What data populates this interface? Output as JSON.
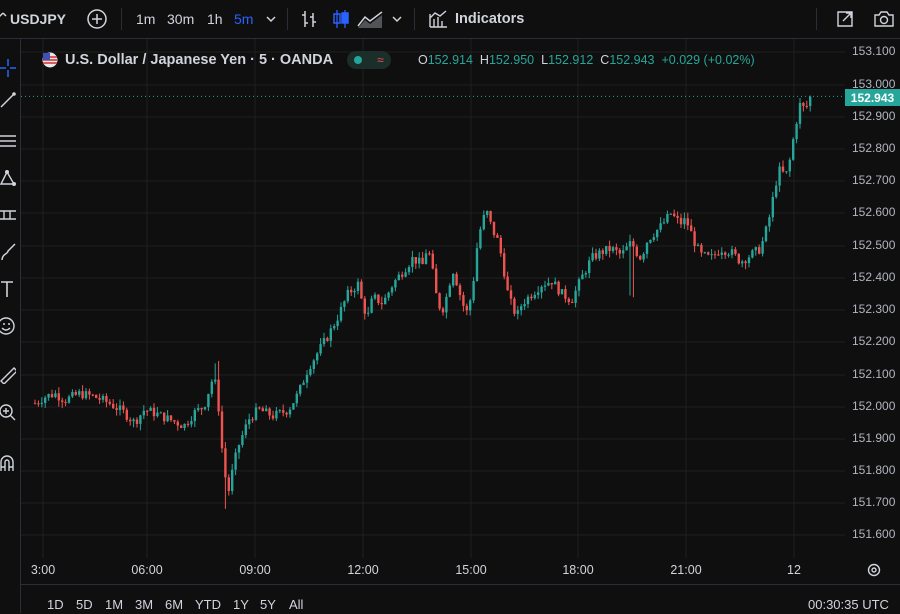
{
  "toolbar": {
    "symbol": "USDJPY",
    "intervals": [
      "1m",
      "30m",
      "1h",
      "5m"
    ],
    "active_interval": "5m",
    "indicators_label": "Indicators"
  },
  "legend": {
    "title": "U.S. Dollar / Japanese Yen · 5 · OANDA",
    "o_label": "O",
    "o": "152.914",
    "h_label": "H",
    "h": "152.950",
    "l_label": "L",
    "l": "152.912",
    "c_label": "C",
    "c": "152.943",
    "change": "+0.029 (+0.02%)"
  },
  "price_axis": {
    "ticks": [
      "153.100",
      "153.000",
      "152.900",
      "152.800",
      "152.700",
      "152.600",
      "152.500",
      "152.400",
      "152.300",
      "152.200",
      "152.100",
      "152.000",
      "151.900",
      "151.800",
      "151.700",
      "151.600"
    ],
    "last_price": "152.943"
  },
  "time_axis": {
    "ticks": [
      "3:00",
      "06:00",
      "09:00",
      "12:00",
      "15:00",
      "18:00",
      "21:00",
      "12"
    ]
  },
  "bottom": {
    "ranges": [
      "1D",
      "5D",
      "1M",
      "3M",
      "6M",
      "YTD",
      "1Y",
      "5Y",
      "All"
    ],
    "clock": "00:30:35 UTC"
  },
  "colors": {
    "up": "#26a69a",
    "down": "#ef5350",
    "accent": "#2962ff",
    "background": "#0f0f0f"
  },
  "chart_data": {
    "type": "candlestick",
    "title": "U.S. Dollar / Japanese Yen · 5 · OANDA",
    "ylim": [
      151.55,
      153.12
    ],
    "x_ticks": [
      "03:00",
      "06:00",
      "09:00",
      "12:00",
      "15:00",
      "18:00",
      "21:00",
      "12"
    ],
    "close_path": [
      [
        0,
        151.99
      ],
      [
        10,
        152.01
      ],
      [
        20,
        152.02
      ],
      [
        30,
        152.0
      ],
      [
        45,
        152.02
      ],
      [
        60,
        152.01
      ],
      [
        75,
        151.99
      ],
      [
        90,
        151.96
      ],
      [
        100,
        151.93
      ],
      [
        110,
        151.97
      ],
      [
        120,
        151.96
      ],
      [
        135,
        151.94
      ],
      [
        150,
        151.92
      ],
      [
        160,
        151.96
      ],
      [
        170,
        151.98
      ],
      [
        180,
        152.08
      ],
      [
        185,
        151.97
      ],
      [
        190,
        151.78
      ],
      [
        195,
        151.72
      ],
      [
        200,
        151.8
      ],
      [
        205,
        151.86
      ],
      [
        210,
        151.9
      ],
      [
        215,
        151.94
      ],
      [
        225,
        151.97
      ],
      [
        240,
        151.95
      ],
      [
        255,
        151.97
      ],
      [
        265,
        152.02
      ],
      [
        275,
        152.1
      ],
      [
        285,
        152.15
      ],
      [
        295,
        152.2
      ],
      [
        305,
        152.26
      ],
      [
        315,
        152.33
      ],
      [
        325,
        152.36
      ],
      [
        330,
        152.29
      ],
      [
        335,
        152.26
      ],
      [
        340,
        152.32
      ],
      [
        350,
        152.3
      ],
      [
        360,
        152.36
      ],
      [
        370,
        152.4
      ],
      [
        380,
        152.44
      ],
      [
        390,
        152.42
      ],
      [
        395,
        152.48
      ],
      [
        400,
        152.4
      ],
      [
        405,
        152.3
      ],
      [
        410,
        152.28
      ],
      [
        415,
        152.33
      ],
      [
        420,
        152.41
      ],
      [
        425,
        152.36
      ],
      [
        430,
        152.3
      ],
      [
        435,
        152.27
      ],
      [
        440,
        152.34
      ],
      [
        445,
        152.48
      ],
      [
        450,
        152.56
      ],
      [
        455,
        152.58
      ],
      [
        460,
        152.53
      ],
      [
        465,
        152.5
      ],
      [
        470,
        152.44
      ],
      [
        475,
        152.34
      ],
      [
        480,
        152.29
      ],
      [
        485,
        152.26
      ],
      [
        490,
        152.3
      ],
      [
        500,
        152.33
      ],
      [
        510,
        152.36
      ],
      [
        520,
        152.37
      ],
      [
        530,
        152.33
      ],
      [
        540,
        152.31
      ],
      [
        550,
        152.38
      ],
      [
        560,
        152.44
      ],
      [
        570,
        152.46
      ],
      [
        580,
        152.47
      ],
      [
        590,
        152.45
      ],
      [
        600,
        152.49
      ],
      [
        605,
        152.46
      ],
      [
        610,
        152.44
      ],
      [
        615,
        152.49
      ],
      [
        620,
        152.51
      ],
      [
        630,
        152.54
      ],
      [
        640,
        152.58
      ],
      [
        645,
        152.56
      ],
      [
        650,
        152.55
      ],
      [
        655,
        152.56
      ],
      [
        660,
        152.52
      ],
      [
        665,
        152.48
      ],
      [
        670,
        152.45
      ],
      [
        680,
        152.44
      ],
      [
        690,
        152.47
      ],
      [
        700,
        152.46
      ],
      [
        710,
        152.43
      ],
      [
        720,
        152.45
      ],
      [
        730,
        152.47
      ],
      [
        735,
        152.52
      ],
      [
        740,
        152.58
      ],
      [
        745,
        152.67
      ],
      [
        750,
        152.72
      ],
      [
        755,
        152.69
      ],
      [
        760,
        152.75
      ],
      [
        765,
        152.85
      ],
      [
        770,
        152.92
      ],
      [
        775,
        152.9
      ],
      [
        780,
        152.94
      ]
    ],
    "close": 152.943,
    "high": 152.95,
    "low": 152.912,
    "open": 152.914
  }
}
